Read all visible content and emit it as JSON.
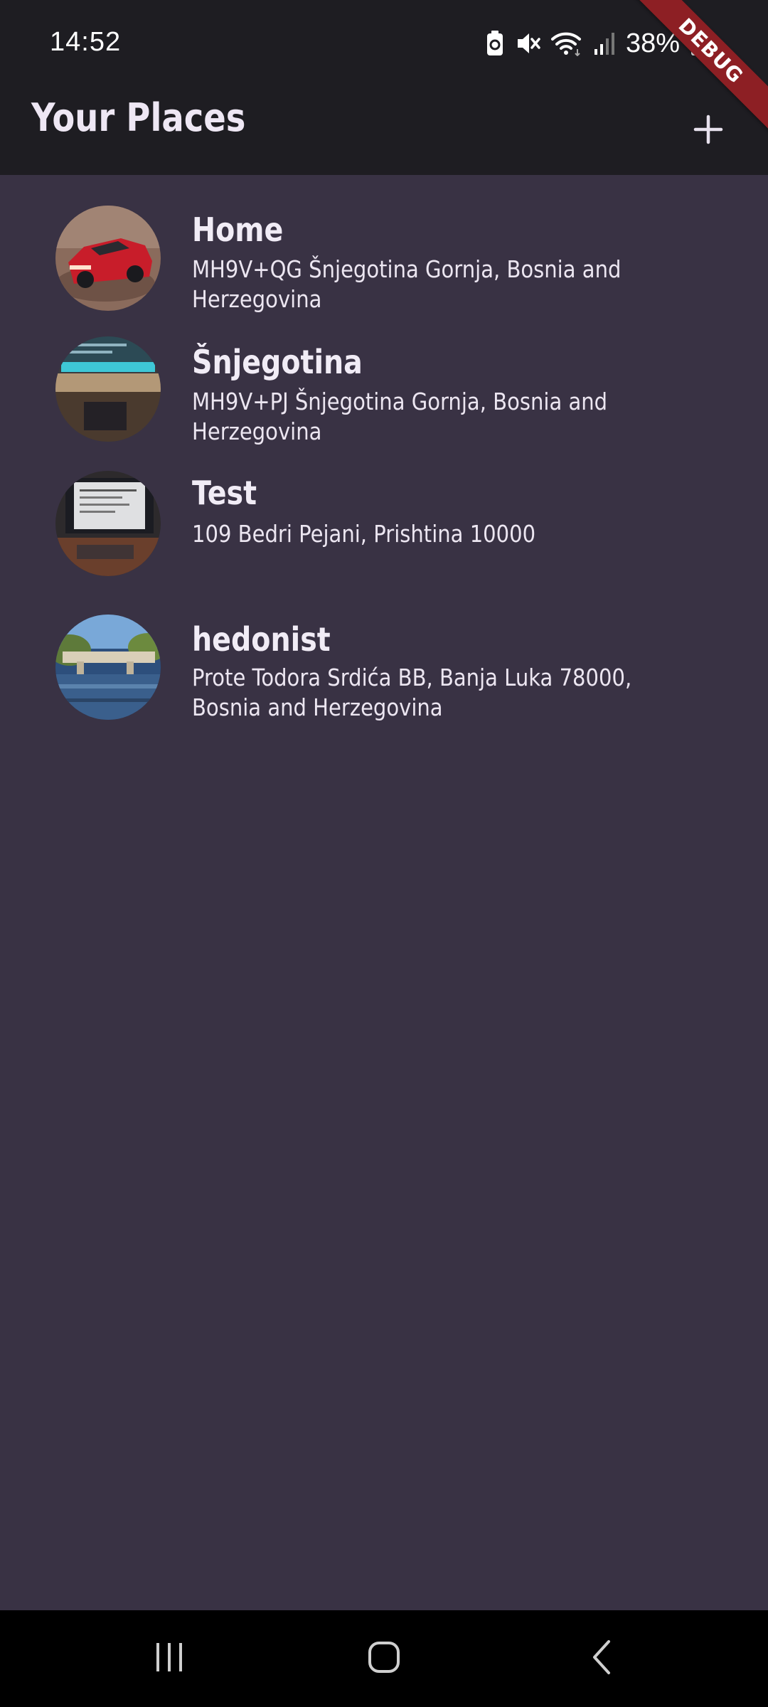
{
  "status_bar": {
    "time": "14:52",
    "battery": "38%",
    "icons": [
      "battery-saver-icon",
      "mute-icon",
      "wifi-icon",
      "signal-icon",
      "battery-icon"
    ]
  },
  "debug_banner": "DEBUG",
  "app_bar": {
    "title": "Your Places",
    "add_icon": "plus-icon"
  },
  "places": [
    {
      "title": "Home",
      "address": "MH9V+QG Šnjegotina Gornja, Bosnia and Herzegovina",
      "image": "red-sports-car-photo"
    },
    {
      "title": "Šnjegotina",
      "address": "MH9V+PJ Šnjegotina Gornja, Bosnia and Herzegovina",
      "image": "desk-keyboard-photo"
    },
    {
      "title": "Test",
      "address": "109 Bedri Pejani, Prishtina 10000",
      "image": "monitor-document-photo"
    },
    {
      "title": "hedonist",
      "address": "Prote Todora Srdića BB, Banja Luka 78000, Bosnia and Herzegovina",
      "image": "river-bridge-photo"
    }
  ],
  "nav_bar": {
    "icons": [
      "recent-apps-icon",
      "home-icon",
      "back-icon"
    ]
  },
  "colors": {
    "background": "#393244",
    "app_bar": "#1e1d22",
    "debug_banner": "#8d1f24",
    "nav_bar": "#000000"
  }
}
